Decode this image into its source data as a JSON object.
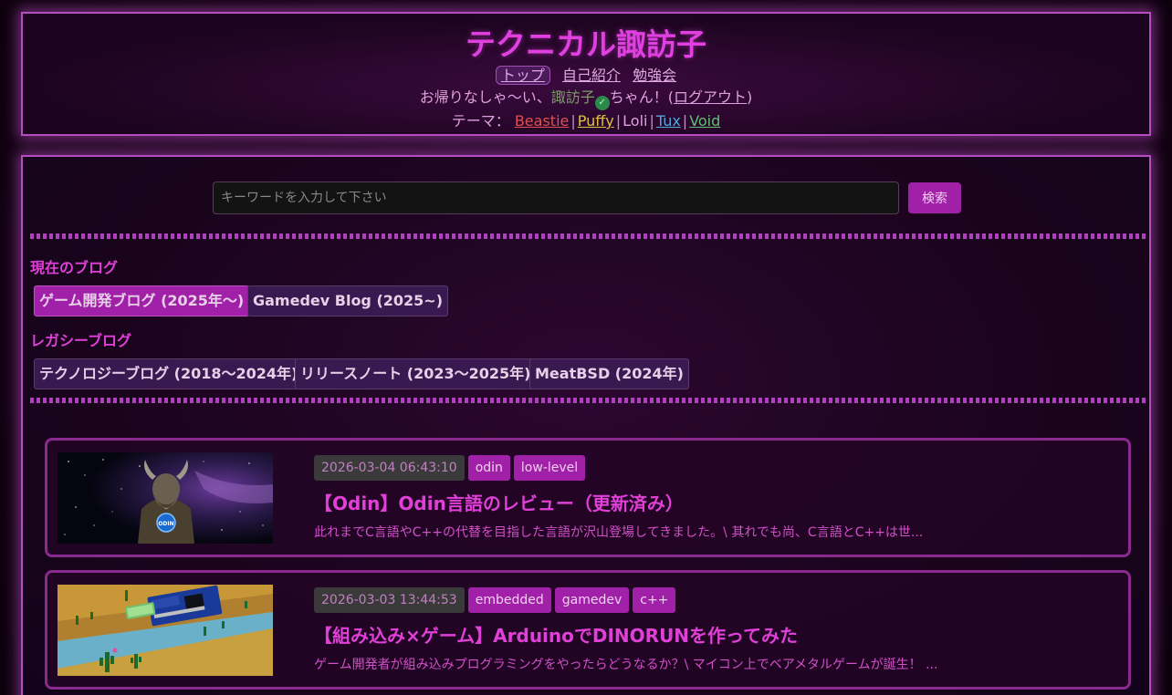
{
  "header": {
    "site_title": "テクニカル諏訪子",
    "nav": [
      {
        "label": "トップ"
      },
      {
        "label": "自己紹介"
      },
      {
        "label": "勉強会"
      }
    ],
    "greeting_prefix": "お帰りなしゃ〜い、",
    "username": "諏訪子",
    "check_glyph": "✓",
    "greeting_suffix": "ちゃん！(",
    "logout_label": "ログアウト",
    "greeting_close": ")",
    "themes_label": "テーマ：",
    "themes": [
      {
        "name": "Beastie",
        "color": "#e05050"
      },
      {
        "name": "Puffy",
        "color": "#e0c040"
      },
      {
        "name": "Loli",
        "color": "#e0a0e0"
      },
      {
        "name": "Tux",
        "color": "#50a8e0"
      },
      {
        "name": "Void",
        "color": "#60c070"
      }
    ],
    "theme_separator": "|"
  },
  "search": {
    "placeholder": "キーワードを入力して下さい",
    "button_label": "検索"
  },
  "current_blogs": {
    "label": "現在のブログ",
    "items": [
      {
        "label": "ゲーム開発ブログ (2025年〜)",
        "active": true
      },
      {
        "label": "Gamedev Blog (2025~)",
        "active": false
      }
    ]
  },
  "legacy_blogs": {
    "label": "レガシーブログ",
    "items": [
      {
        "label": "テクノロジーブログ (2018〜2024年)"
      },
      {
        "label": "リリースノート (2023〜2025年)"
      },
      {
        "label": "MeatBSD (2024年)"
      }
    ]
  },
  "posts": [
    {
      "date": "2026-03-04 06:43:10",
      "tags": [
        "odin",
        "low-level"
      ],
      "title": "【Odin】Odin言語のレビュー（更新済み）",
      "excerpt": "此れまでC言語やC++の代替を目指した言語が沢山登場してきました。\\ 其れでも尚、C言語とC++は世...",
      "thumb_badge": "ODIN"
    },
    {
      "date": "2026-03-03 13:44:53",
      "tags": [
        "embedded",
        "gamedev",
        "c++"
      ],
      "title": "【組み込み×ゲーム】ArduinoでDINORUNを作ってみた",
      "excerpt": "ゲーム開発者が組み込みプログラミングをやったらどうなるか？\\ マイコン上でベアメタルゲームが誕生！ ..."
    }
  ]
}
